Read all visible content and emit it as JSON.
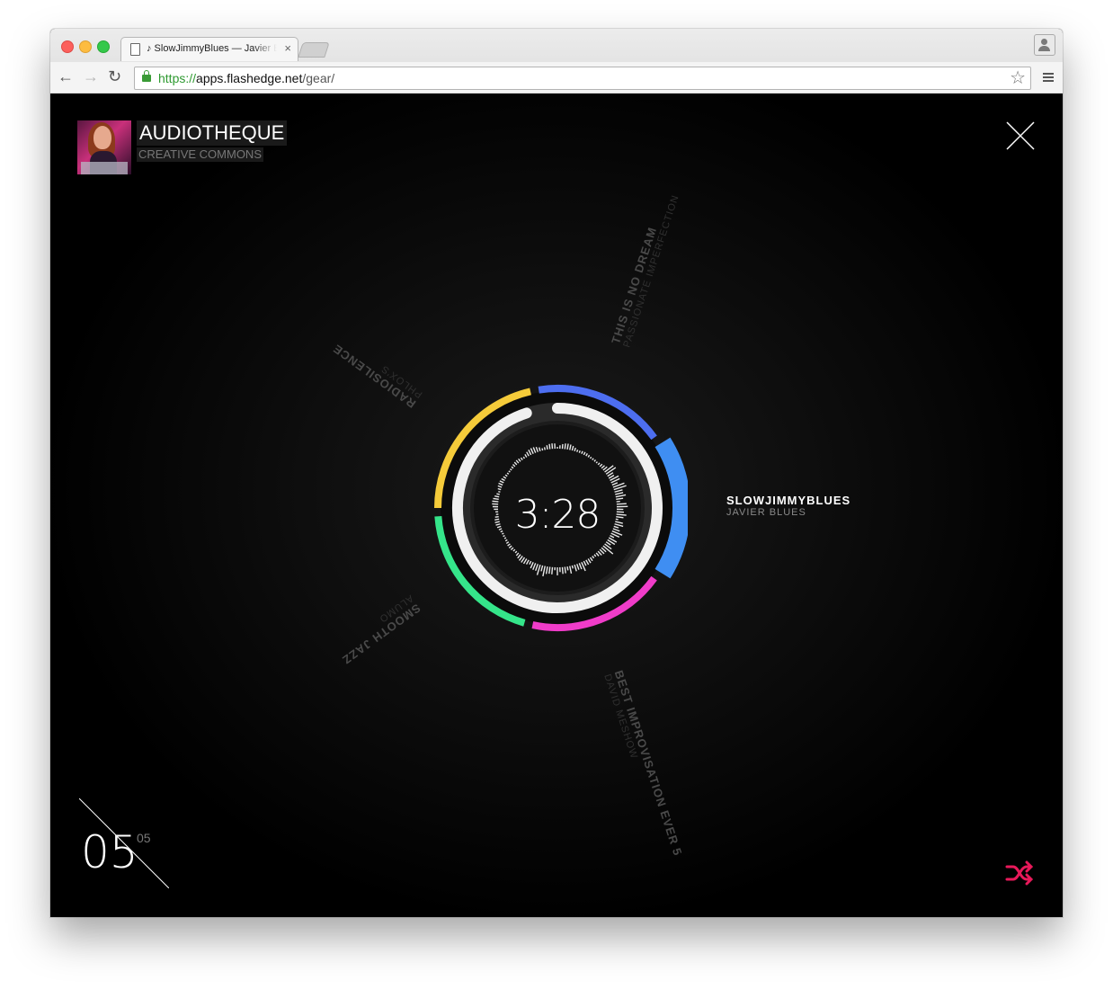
{
  "browser": {
    "tab_title": "♪ SlowJimmyBlues — Javier Blues",
    "tab_close": "×",
    "url_scheme": "https://",
    "url_host": "apps.flashedge.net",
    "url_path": "/gear/",
    "nav_back": "←",
    "nav_forward": "→",
    "nav_reload": "↻",
    "bookmark": "☆"
  },
  "app": {
    "brand_title": "AUDIOTHEQUE",
    "brand_subtitle": "CREATIVE COMMONS",
    "time": "3:28",
    "now_playing": {
      "title": "SLOWJIMMYBLUES",
      "artist": "JAVIER BLUES"
    },
    "tracks": [
      {
        "title": "THIS IS NO DREAM",
        "artist": "PASSIONATE IMPERFECTION"
      },
      {
        "title": "RADIOSILENCE",
        "artist": "PHLOX'S"
      },
      {
        "title": "SMOOTH JAZZ",
        "artist": "ALUMO"
      },
      {
        "title": "BEST IMPROVISATION EVER 5",
        "artist": "DAVID MESHOW"
      }
    ],
    "track_number": "05",
    "track_total": "05",
    "progress": 0.95,
    "colors": {
      "ring_blue": "#4d6ef0",
      "ring_lightblue": "#3f8ef2",
      "ring_pink": "#f03cc9",
      "ring_green": "#35e58a",
      "ring_yellow": "#f5cb3a",
      "shuffle": "#e8195a",
      "progress_track": "#f0f0f0"
    }
  }
}
